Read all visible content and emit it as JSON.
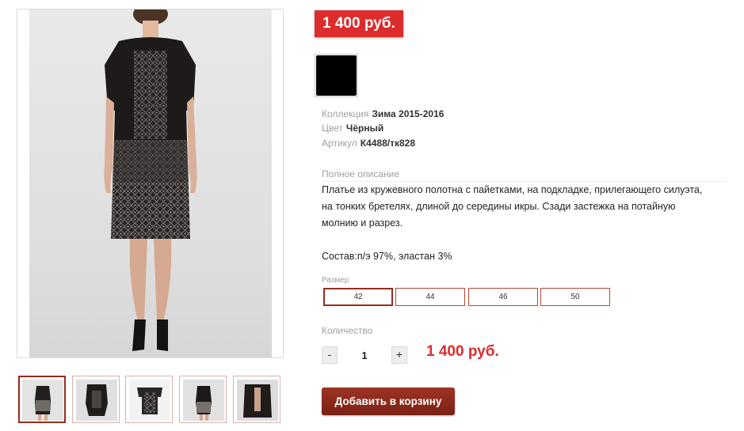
{
  "product": {
    "price": "1 400 руб.",
    "color_swatch": "#000000",
    "attributes": [
      {
        "key": "Коллекция",
        "value": "Зима 2015-2016"
      },
      {
        "key": "Цвет",
        "value": "Чёрный"
      },
      {
        "key": "Артикул",
        "value": "К4488/тк828"
      }
    ],
    "description_title": "Полное описание",
    "description_lines": [
      "Платье  из  кружевного полотна с пайетками, на подкладке, прилегающего силуэта,",
      "на тонких бретелях, длиной до середины икры. Сзади застежка на потайную",
      "молнию и разрез."
    ],
    "composition": "Состав:п/э 97%, эластан 3%",
    "size_title": "Размер",
    "sizes": [
      "42",
      "44",
      "46",
      "50"
    ],
    "selected_size": "42",
    "quantity_title": "Количество",
    "quantity": "1",
    "minus": "-",
    "plus": "+",
    "total": "1 400 руб.",
    "add_to_cart": "Добавить в корзину"
  },
  "gallery": {
    "thumbnail_count": 5,
    "active_thumbnail": 1
  },
  "colors": {
    "accent_red": "#dc2c2e",
    "button_red": "#8b2a1b",
    "size_border": "#b74735"
  }
}
